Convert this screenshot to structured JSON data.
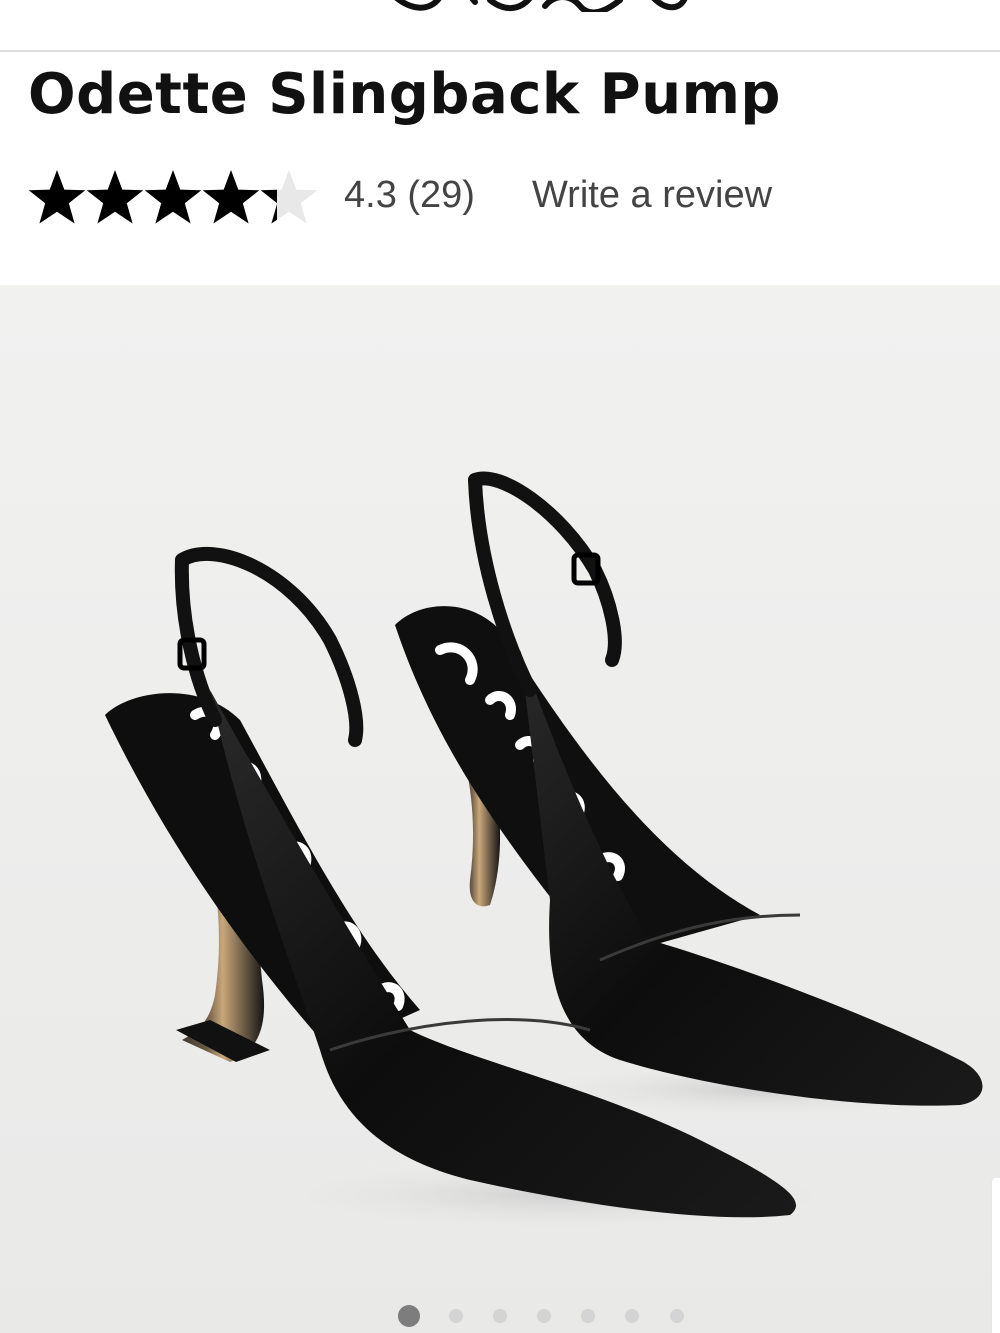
{
  "header": {
    "logo_icon": "brand-script-logo-icon"
  },
  "product": {
    "title": "Odette Slingback Pump",
    "rating": {
      "value": 4.3,
      "max": 5,
      "text": "4.3 (29)",
      "star_icon": "star-icon",
      "filled_color": "#000000",
      "empty_color": "#e8e8e8"
    },
    "write_review_label": "Write a review"
  },
  "gallery": {
    "image_icon": "black-slingback-pumps-photo",
    "background_color": "#f0f0ef",
    "image_count": 7,
    "active_index": 0
  }
}
